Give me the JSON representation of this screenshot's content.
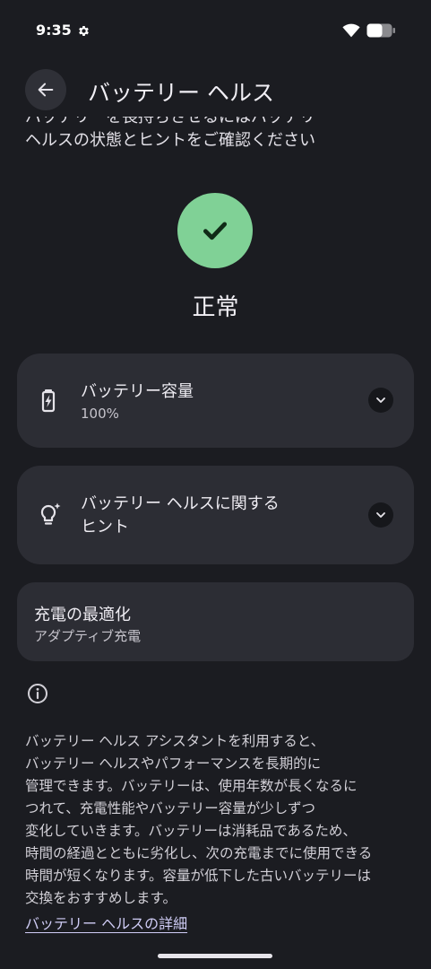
{
  "status_bar": {
    "time": "9:35",
    "icons": [
      "gear-icon",
      "wifi-icon",
      "battery-icon"
    ]
  },
  "header": {
    "back_icon": "arrow-back-icon",
    "title": "バッテリー ヘルス"
  },
  "intro": {
    "line1": "バッテリーを長持ちさせるにはバッテリー",
    "line2": "ヘルスの状態とヒントをご確認ください"
  },
  "status": {
    "icon": "check-icon",
    "label": "正常",
    "color": "#80d196"
  },
  "cards": {
    "capacity": {
      "icon": "battery-charging-icon",
      "title": "バッテリー容量",
      "value": "100%",
      "expand_icon": "chevron-down-icon"
    },
    "tips": {
      "icon": "lightbulb-icon",
      "title_line1": "バッテリー ヘルスに関する",
      "title_line2": "ヒント",
      "expand_icon": "chevron-down-icon"
    },
    "optimize": {
      "title": "充電の最適化",
      "subtitle": "アダプティブ充電"
    }
  },
  "info": {
    "icon": "info-icon",
    "lines": [
      "バッテリー ヘルス アシスタントを利用すると、",
      "バッテリー ヘルスやパフォーマンスを長期的に",
      "管理できます。バッテリーは、使用年数が長くなるに",
      "つれて、充電性能やバッテリー容量が少しずつ",
      "変化していきます。バッテリーは消耗品であるため、",
      "時間の経過とともに劣化し、次の充電までに使用できる",
      "時間が短くなります。容量が低下した古いバッテリーは",
      "交換をおすすめします。"
    ],
    "link": "バッテリー ヘルスの詳細"
  }
}
